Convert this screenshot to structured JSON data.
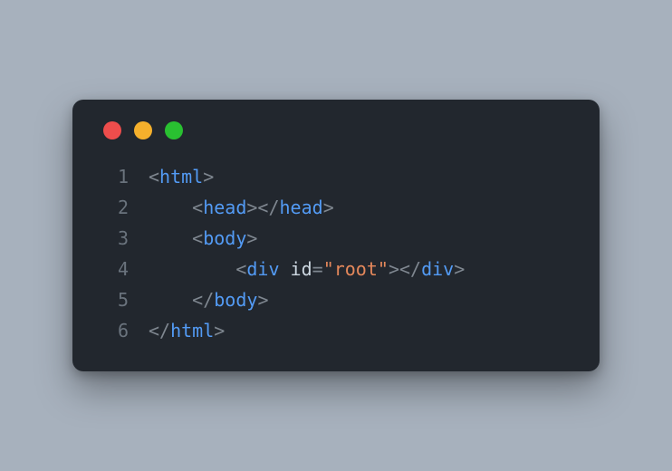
{
  "window": {
    "traffic_lights": {
      "close": "red",
      "minimize": "yellow",
      "zoom": "green"
    }
  },
  "syntax_colors": {
    "punct": "#7f8790",
    "tag": "#539bf5",
    "attr": "#cdd7e1",
    "string": "#e5885b",
    "linenum": "#6a737d"
  },
  "code": {
    "lines": [
      {
        "num": "1",
        "indent": "",
        "tokens": [
          {
            "t": "pn",
            "v": "<"
          },
          {
            "t": "tg",
            "v": "html"
          },
          {
            "t": "pn",
            "v": ">"
          }
        ]
      },
      {
        "num": "2",
        "indent": "    ",
        "tokens": [
          {
            "t": "pn",
            "v": "<"
          },
          {
            "t": "tg",
            "v": "head"
          },
          {
            "t": "pn",
            "v": "></"
          },
          {
            "t": "tg",
            "v": "head"
          },
          {
            "t": "pn",
            "v": ">"
          }
        ]
      },
      {
        "num": "3",
        "indent": "    ",
        "tokens": [
          {
            "t": "pn",
            "v": "<"
          },
          {
            "t": "tg",
            "v": "body"
          },
          {
            "t": "pn",
            "v": ">"
          }
        ]
      },
      {
        "num": "4",
        "indent": "        ",
        "tokens": [
          {
            "t": "pn",
            "v": "<"
          },
          {
            "t": "tg",
            "v": "div"
          },
          {
            "t": "pn",
            "v": " "
          },
          {
            "t": "at",
            "v": "id"
          },
          {
            "t": "eq",
            "v": "="
          },
          {
            "t": "st",
            "v": "\"root\""
          },
          {
            "t": "pn",
            "v": "></"
          },
          {
            "t": "tg",
            "v": "div"
          },
          {
            "t": "pn",
            "v": ">"
          }
        ]
      },
      {
        "num": "5",
        "indent": "    ",
        "tokens": [
          {
            "t": "pn",
            "v": "</"
          },
          {
            "t": "tg",
            "v": "body"
          },
          {
            "t": "pn",
            "v": ">"
          }
        ]
      },
      {
        "num": "6",
        "indent": "",
        "tokens": [
          {
            "t": "pn",
            "v": "</"
          },
          {
            "t": "tg",
            "v": "html"
          },
          {
            "t": "pn",
            "v": ">"
          }
        ]
      }
    ]
  }
}
